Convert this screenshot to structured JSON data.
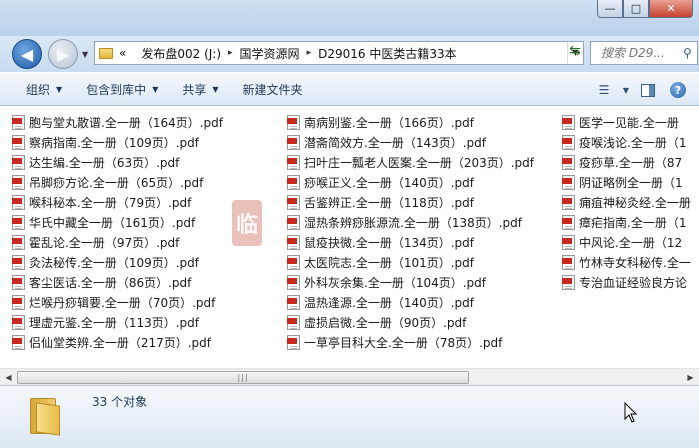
{
  "window": {
    "minimize_label": "—",
    "maximize_label": "□",
    "close_label": "✕"
  },
  "address": {
    "prefix": "«",
    "crumbs": [
      "发布盘002 (J:)",
      "国学资源网",
      "D29016 中医类古籍33本"
    ],
    "separator": "▸"
  },
  "search": {
    "placeholder": "搜索 D29..."
  },
  "toolbar": {
    "organize": "组织",
    "include_in_library": "包含到库中",
    "share": "共享",
    "new_folder": "新建文件夹"
  },
  "files": {
    "column1": [
      "胞与堂丸散谱.全一册（164页）.pdf",
      "察病指南.全一册（109页）.pdf",
      "达生编.全一册（63页）.pdf",
      "吊脚痧方论.全一册（65页）.pdf",
      "喉科秘本.全一册（79页）.pdf",
      "华氏中藏全一册（161页）.pdf",
      "霍乱论.全一册（97页）.pdf",
      "灸法秘传.全一册（109页）.pdf",
      "客尘医话.全一册（86页）.pdf",
      "烂喉丹痧辑要.全一册（70页）.pdf",
      "理虚元鉴.全一册（113页）.pdf",
      "侣仙堂类辨.全一册（217页）.pdf"
    ],
    "column2": [
      "南病别鉴.全一册（166页）.pdf",
      "潜斋简效方.全一册（143页）.pdf",
      "扫叶庄一瓢老人医案.全一册（203页）.pdf",
      "痧喉正义.全一册（140页）.pdf",
      "舌鉴辨正.全一册（118页）.pdf",
      "湿热条辨痧胀源流.全一册（138页）.pdf",
      "鼠疫抉微.全一册（134页）.pdf",
      "太医院志.全一册（101页）.pdf",
      "外科灰余集.全一册（104页）.pdf",
      "温热逢源.全一册（140页）.pdf",
      "虚损启微.全一册（90页）.pdf",
      "一草亭目科大全.全一册（78页）.pdf"
    ],
    "column3": [
      "医学一见能.全一册",
      "疫喉浅论.全一册（1",
      "疫痧草.全一册（87",
      "阴证略例全一册（1",
      "痈疽神秘灸经.全一册",
      "瘴疟指南.全一册（1",
      "中风论.全一册（12",
      "竹林寺女科秘传.全一",
      "专治血证经验良方论"
    ]
  },
  "watermark": {
    "text": "临"
  },
  "details": {
    "item_count": "33 个对象"
  }
}
